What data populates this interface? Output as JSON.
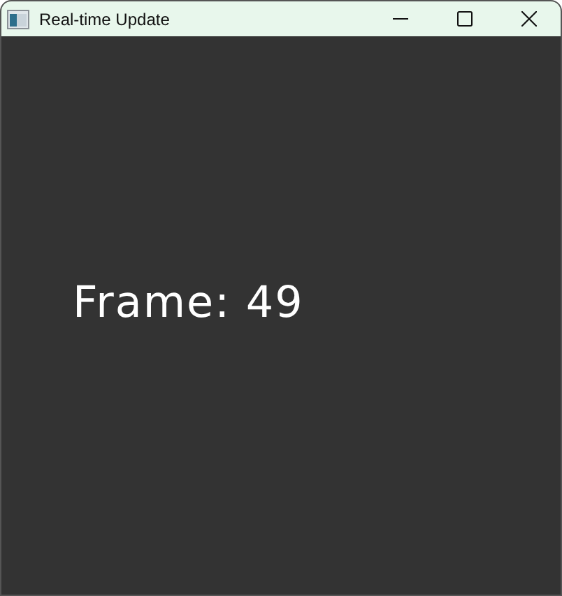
{
  "window": {
    "title": "Real-time Update"
  },
  "canvas": {
    "text": "Frame: 49"
  }
}
